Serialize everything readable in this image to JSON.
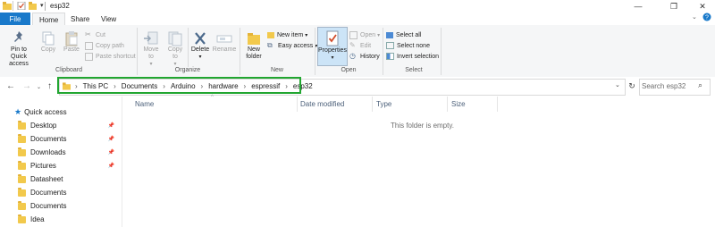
{
  "window": {
    "title": "esp32",
    "controls": {
      "minimize": "—",
      "maximize": "❐",
      "close": "✕"
    }
  },
  "tabs": {
    "file": "File",
    "items": [
      "Home",
      "Share",
      "View"
    ],
    "active": "Home"
  },
  "ribbon": {
    "clipboard": {
      "label": "Clipboard",
      "pin": "Pin to Quick access",
      "copy": "Copy",
      "paste": "Paste",
      "cut": "Cut",
      "copy_path": "Copy path",
      "paste_shortcut": "Paste shortcut"
    },
    "organize": {
      "label": "Organize",
      "move_to": "Move to",
      "copy_to": "Copy to",
      "delete": "Delete",
      "rename": "Rename"
    },
    "new": {
      "label": "New",
      "new_folder": "New folder",
      "new_item": "New item",
      "easy_access": "Easy access"
    },
    "open": {
      "label": "Open",
      "properties": "Properties",
      "open": "Open",
      "edit": "Edit",
      "history": "History"
    },
    "select": {
      "label": "Select",
      "select_all": "Select all",
      "select_none": "Select none",
      "invert_selection": "Invert selection"
    }
  },
  "address": {
    "crumbs": [
      "This PC",
      "Documents",
      "Arduino",
      "hardware",
      "espressif",
      "esp32"
    ],
    "search_placeholder": "Search esp32"
  },
  "nav_pane": {
    "quick_access": "Quick access",
    "items": [
      {
        "label": "Desktop",
        "pinned": true
      },
      {
        "label": "Documents",
        "pinned": true
      },
      {
        "label": "Downloads",
        "pinned": true
      },
      {
        "label": "Pictures",
        "pinned": true
      },
      {
        "label": "Datasheet",
        "pinned": false
      },
      {
        "label": "Documents",
        "pinned": false
      },
      {
        "label": "Documents",
        "pinned": false
      },
      {
        "label": "Idea",
        "pinned": false
      }
    ]
  },
  "content": {
    "columns": [
      "Name",
      "Date modified",
      "Type",
      "Size"
    ],
    "empty_message": "This folder is empty."
  },
  "colors": {
    "file_tab": "#1979ca",
    "highlight_border": "#22a631",
    "ribbon_bg": "#f5f6f7",
    "folder": "#f2c94c"
  }
}
